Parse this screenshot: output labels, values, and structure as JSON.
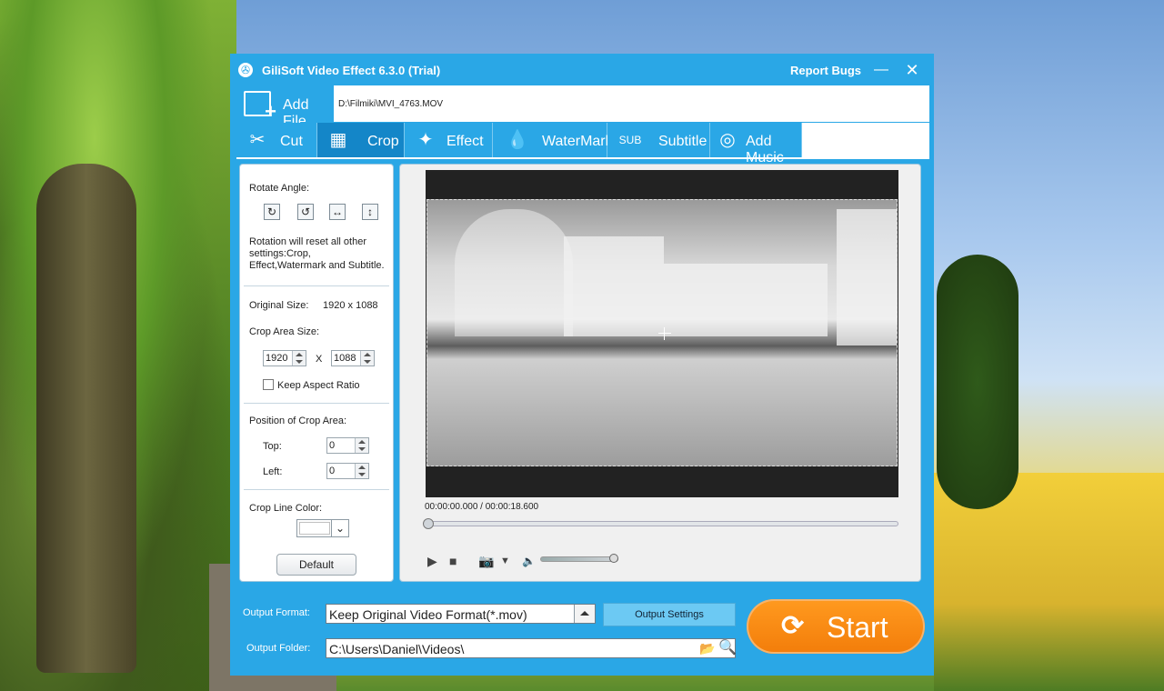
{
  "window": {
    "title": "GiliSoft Video Effect 6.3.0 (Trial)",
    "report_bugs": "Report Bugs",
    "minimize": "—",
    "close": "✕"
  },
  "filebar": {
    "add_file_label": "Add File",
    "file_path": "D:\\Filmiki\\MVI_4763.MOV"
  },
  "tabs": [
    {
      "label": "Cut",
      "icon": "cut-icon",
      "active": false
    },
    {
      "label": "Crop",
      "icon": "crop-icon",
      "active": true
    },
    {
      "label": "Effect",
      "icon": "effect-icon",
      "active": false
    },
    {
      "label": "WaterMark",
      "icon": "watermark-icon",
      "active": false
    },
    {
      "label": "Subtitle",
      "icon": "subtitle-icon",
      "active": false
    },
    {
      "label": "Add Music",
      "icon": "music-icon",
      "active": false
    }
  ],
  "crop_panel": {
    "rotate_angle_label": "Rotate Angle:",
    "rotate_buttons": [
      "rotate-clockwise-icon",
      "rotate-counterclockwise-icon",
      "flip-horizontal-icon",
      "flip-vertical-icon"
    ],
    "rotation_note": "Rotation will reset all other settings:Crop, Effect,Watermark and Subtitle.",
    "original_size_label": "Original Size:",
    "original_size_value": "1920 x 1088",
    "crop_area_size_label": "Crop Area Size:",
    "crop_width": "1920",
    "crop_x": "X",
    "crop_height": "1088",
    "keep_aspect_label": "Keep Aspect Ratio",
    "keep_aspect_checked": false,
    "position_label": "Position of Crop Area:",
    "top_label": "Top:",
    "top_value": "0",
    "left_label": "Left:",
    "left_value": "0",
    "crop_line_color_label": "Crop Line Color:",
    "crop_line_color": "#ffffff",
    "default_button": "Default"
  },
  "player": {
    "time": "00:00:00.000 / 00:00:18.600",
    "seek_position": 0,
    "volume": 0.95
  },
  "output": {
    "format_label": "Output Format:",
    "format_value": "Keep Original Video Format(*.mov)",
    "settings_button": "Output Settings",
    "folder_label": "Output Folder:",
    "folder_value": "C:\\Users\\Daniel\\Videos\\",
    "start_label": "Start"
  },
  "colors": {
    "accent": "#2aa7e6",
    "active_tab": "#1486c8",
    "start": "#f58a14"
  }
}
